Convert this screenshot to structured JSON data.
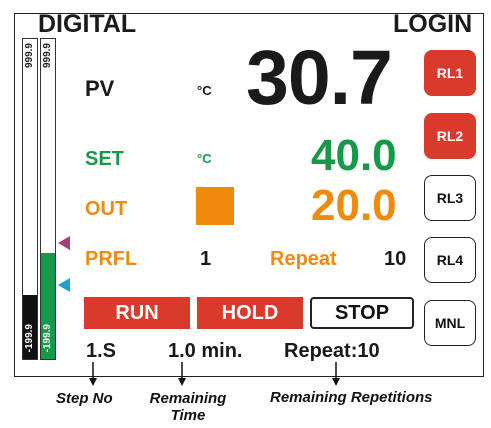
{
  "header": {
    "left_title": "DIGITAL",
    "right_title": "LOGIN"
  },
  "bargraph": {
    "pv_bar": {
      "max_label": "999.9",
      "min_label": "-199.9",
      "level_fraction": 0.2,
      "color": "#111111"
    },
    "out_bar": {
      "max_label": "999.9",
      "min_label": "-199.9",
      "level_fraction": 0.33,
      "color": "#159a4a"
    },
    "marker_upper_color": "#a0407a",
    "marker_lower_color": "#1aa0cf"
  },
  "pv": {
    "label": "PV",
    "unit": "°C",
    "value": "30.7"
  },
  "set": {
    "label": "SET",
    "unit": "°C",
    "value": "40.0"
  },
  "out": {
    "label": "OUT",
    "value": "20.0",
    "indicator_color": "#f08a0f"
  },
  "profile": {
    "label": "PRFL",
    "number": "1",
    "repeat_label": "Repeat",
    "repeat_value": "10"
  },
  "controls": {
    "run_label": "RUN",
    "hold_label": "HOLD",
    "stop_label": "STOP"
  },
  "status": {
    "step": "1.S",
    "remaining_time": "1.0 min.",
    "remaining_repeat": "Repeat:10"
  },
  "relays": [
    {
      "label": "RL1",
      "active": true
    },
    {
      "label": "RL2",
      "active": true
    },
    {
      "label": "RL3",
      "active": false
    },
    {
      "label": "RL4",
      "active": false
    },
    {
      "label": "MNL",
      "active": false
    }
  ],
  "annotations": {
    "step_no": "Step No",
    "remaining_time_line1": "Remaining",
    "remaining_time_line2": "Time",
    "remaining_repetitions": "Remaining Repetitions"
  },
  "colors": {
    "green": "#159a4a",
    "orange": "#f08a0f",
    "red": "#d93a2b"
  }
}
